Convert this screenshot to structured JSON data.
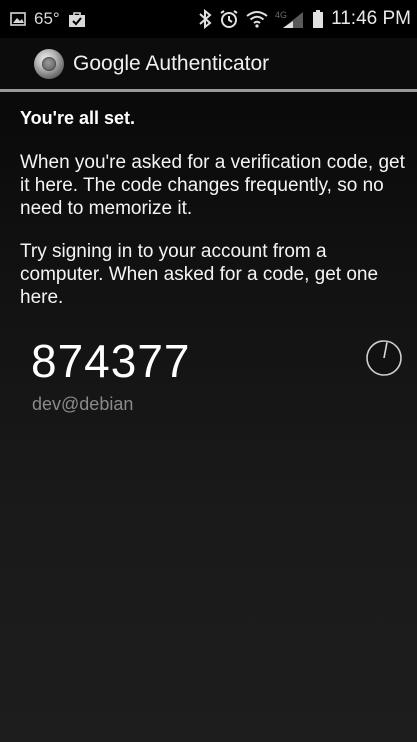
{
  "status_bar": {
    "temperature": "65°",
    "time": "11:46 PM",
    "network_label": "4G",
    "icons": [
      "picture-icon",
      "shopping-bag-icon",
      "bluetooth-icon",
      "alarm-icon",
      "wifi-icon",
      "signal-icon",
      "battery-icon"
    ]
  },
  "action_bar": {
    "title": "Google Authenticator",
    "icon": "authenticator-logo-icon"
  },
  "main": {
    "heading": "You're all set.",
    "paragraph_1": "When you're asked for a verification code, get it here. The code changes frequently, so no need to memorize it.",
    "paragraph_2": "Try signing in to your account from a computer. When asked for a code, get one here."
  },
  "accounts": [
    {
      "code": "874377",
      "name": "dev@debian",
      "countdown_remaining_fraction": 0.97
    }
  ],
  "colors": {
    "background": "#000000",
    "text": "#ffffff",
    "account_text": "#8a8a8a",
    "divider": "#9a9a9a"
  }
}
